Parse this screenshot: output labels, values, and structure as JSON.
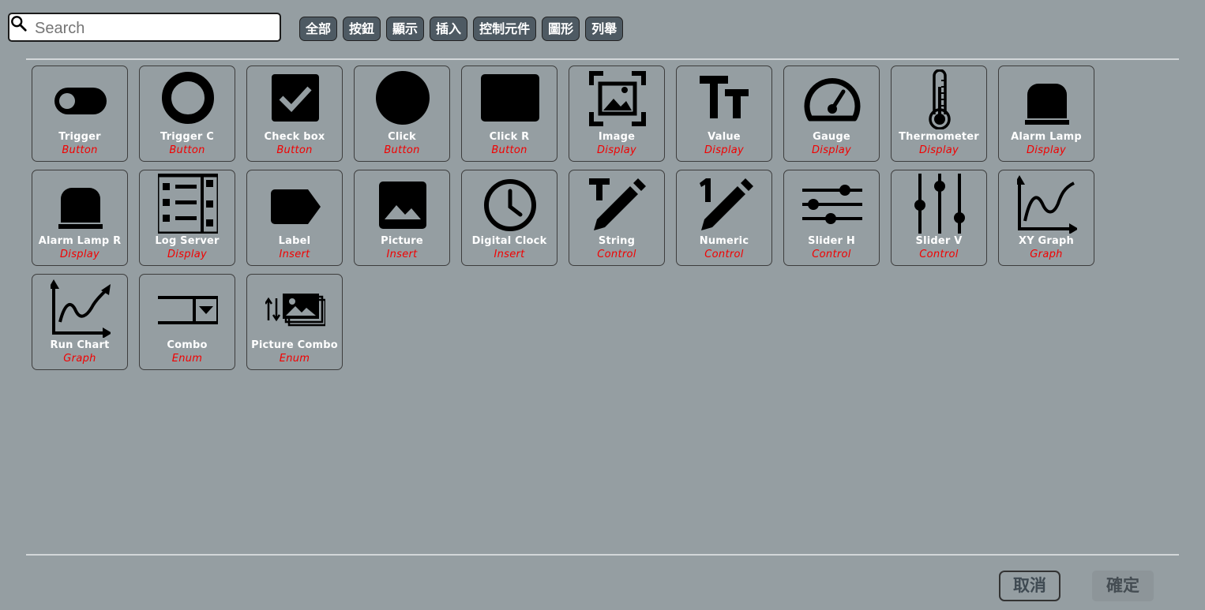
{
  "search": {
    "placeholder": "Search",
    "value": ""
  },
  "filters": [
    "全部",
    "按鈕",
    "顯示",
    "插入",
    "控制元件",
    "圖形",
    "列舉"
  ],
  "items": [
    {
      "name": "Trigger",
      "category": "Button",
      "icon": "toggle-icon"
    },
    {
      "name": "Trigger C",
      "category": "Button",
      "icon": "ring-icon"
    },
    {
      "name": "Check box",
      "category": "Button",
      "icon": "checkbox-icon"
    },
    {
      "name": "Click",
      "category": "Button",
      "icon": "circle-icon"
    },
    {
      "name": "Click R",
      "category": "Button",
      "icon": "rounded-square-icon"
    },
    {
      "name": "Image",
      "category": "Display",
      "icon": "image-frame-icon"
    },
    {
      "name": "Value",
      "category": "Display",
      "icon": "text-size-icon"
    },
    {
      "name": "Gauge",
      "category": "Display",
      "icon": "gauge-icon"
    },
    {
      "name": "Thermometer",
      "category": "Display",
      "icon": "thermometer-icon"
    },
    {
      "name": "Alarm Lamp",
      "category": "Display",
      "icon": "alarm-lamp-icon"
    },
    {
      "name": "Alarm Lamp R",
      "category": "Display",
      "icon": "alarm-lamp-icon"
    },
    {
      "name": "Log Server",
      "category": "Display",
      "icon": "log-list-icon"
    },
    {
      "name": "Label",
      "category": "Insert",
      "icon": "label-tag-icon"
    },
    {
      "name": "Picture",
      "category": "Insert",
      "icon": "picture-icon"
    },
    {
      "name": "Digital Clock",
      "category": "Insert",
      "icon": "clock-icon"
    },
    {
      "name": "String",
      "category": "Control",
      "icon": "text-edit-icon"
    },
    {
      "name": "Numeric",
      "category": "Control",
      "icon": "number-edit-icon"
    },
    {
      "name": "Slider H",
      "category": "Control",
      "icon": "slider-horizontal-icon"
    },
    {
      "name": "Slider V",
      "category": "Control",
      "icon": "slider-vertical-icon"
    },
    {
      "name": "XY Graph",
      "category": "Graph",
      "icon": "xy-graph-icon"
    },
    {
      "name": "Run Chart",
      "category": "Graph",
      "icon": "run-chart-icon"
    },
    {
      "name": "Combo",
      "category": "Enum",
      "icon": "combo-dropdown-icon"
    },
    {
      "name": "Picture Combo",
      "category": "Enum",
      "icon": "picture-combo-icon"
    }
  ],
  "footer": {
    "cancel_label": "取消",
    "ok_label": "確定"
  }
}
